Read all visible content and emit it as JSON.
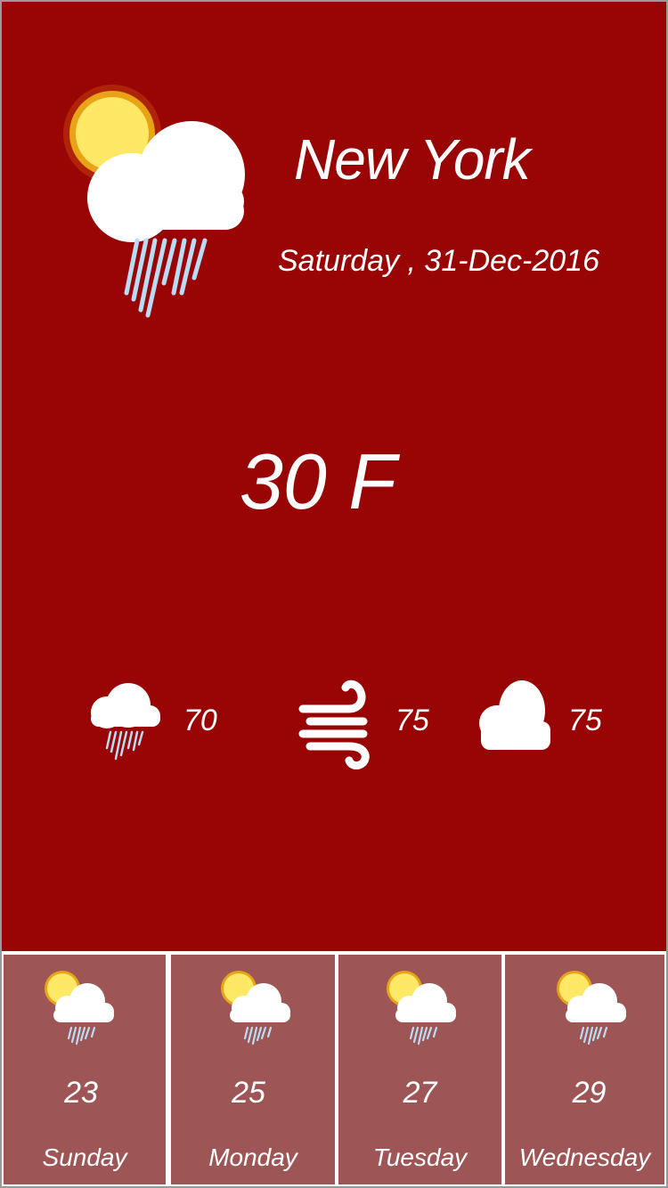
{
  "current": {
    "city": "New York",
    "date": "Saturday , 31-Dec-2016",
    "temperature": "30 F",
    "icon": "partly-sunny-rain-icon"
  },
  "stats": [
    {
      "icon": "rain-cloud-icon",
      "value": "70"
    },
    {
      "icon": "wind-icon",
      "value": "75"
    },
    {
      "icon": "cloud-icon",
      "value": "75"
    }
  ],
  "forecast": [
    {
      "day": "Sunday",
      "temp": "23",
      "icon": "partly-sunny-rain-icon"
    },
    {
      "day": "Monday",
      "temp": "25",
      "icon": "partly-sunny-rain-icon"
    },
    {
      "day": "Tuesday",
      "temp": "27",
      "icon": "partly-sunny-rain-icon"
    },
    {
      "day": "Wednesday",
      "temp": "29",
      "icon": "partly-sunny-rain-icon"
    }
  ],
  "colors": {
    "main_background": "#990404",
    "forecast_card": "#9e5555",
    "text": "#ffffff",
    "sun": "#ffe866",
    "sun_ring": "#e8a317",
    "rain": "#b9dcf5"
  }
}
